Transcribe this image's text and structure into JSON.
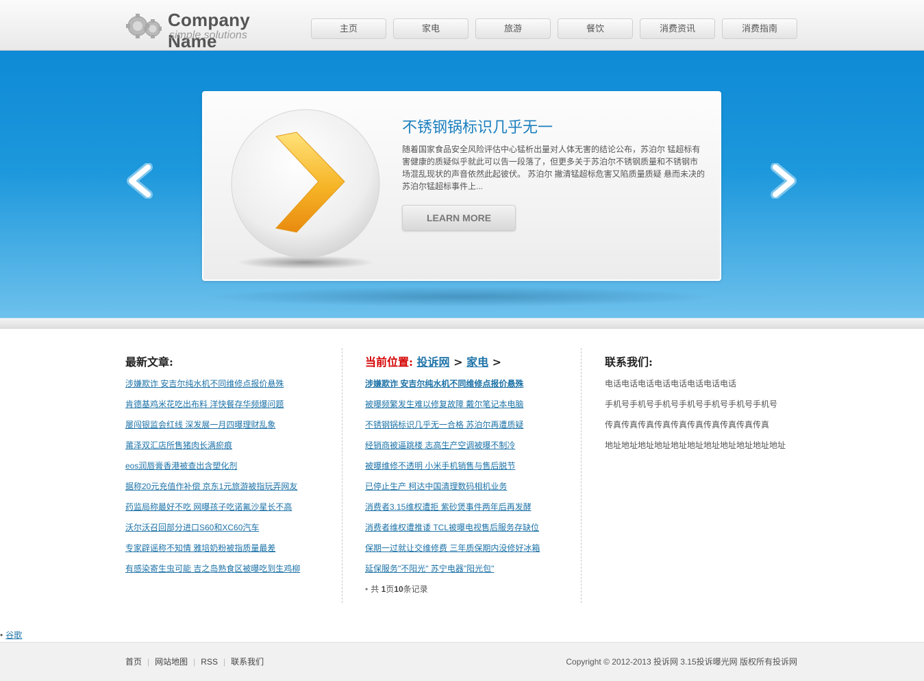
{
  "header": {
    "company_name": "Company Name",
    "tagline": "simple solutions",
    "nav": [
      "主页",
      "家电",
      "旅游",
      "餐饮",
      "消费资讯",
      "消费指南"
    ]
  },
  "slider": {
    "title": "不锈钢锅标识几乎无一",
    "text": "随着国家食品安全风险评估中心锰析出量对人体无害的结论公布，苏泊尔 锰超标有害健康的质疑似乎就此可以告一段落了，但更多关于苏泊尔不锈钢质量和不锈钢市场混乱现状的声音依然此起彼伏。 苏泊尔 撇清锰超标危害又陷质量质疑 悬而未决的苏泊尔锰超标事件上...",
    "button": "LEARN MORE"
  },
  "latest": {
    "title": "最新文章:",
    "items": [
      "涉嫌欺诈 安吉尔纯水机不同维修点报价悬殊",
      "肯德基鸡米花吃出布料 洋快餐存华频爆问题",
      "屡闯银监会红线 深发展一月四曝理财乱象",
      "莆泽双汇店所售猪肉长满瘀痕",
      "eos润唇膏香港被查出含塑化剂",
      "据称20元充值作补偿 京东1元旅游被指玩弄网友",
      "药监局称最好不吃 网曝孩子吃诺氟沙星长不高",
      "沃尔沃召回部分进口S60和XC60汽车",
      "专家辟谣称不知情 雅培奶粉被指质量最差",
      "有感染寄生虫可能 吉之岛熟食区被曝吃到生鸡柳"
    ]
  },
  "current": {
    "location_label": "当前位置:",
    "crumbs": [
      "投诉网",
      "家电"
    ],
    "sep": ">",
    "items": [
      "涉嫌欺诈 安吉尔纯水机不同维修点报价悬殊",
      "被曝频繁发生难以修复故障 戴尔笔记本电脑",
      "不锈钢锅标识几乎无一合格 苏泊尔再遭质疑",
      "经销商被逼跳楼 志高生产空调被曝不制冷",
      "被曝维修不透明 小米手机销售与售后脱节",
      "已停止生产 柯达中国清理数码相机业务",
      "消费者3.15维权遭拒 紫砂煲事件两年后再发酵",
      "消费者维权遭推诿 TCL被曝电视售后服务存缺位",
      "保期一过就让交维修费 三年质保期内没修好冰箱",
      "延保服务\"不阳光\" 苏宁电器\"阳光包\""
    ],
    "pager_prefix": "共",
    "pager_pages": "1",
    "pager_mid": "页",
    "pager_records": "10",
    "pager_suffix": "条记录"
  },
  "contact": {
    "title": "联系我们:",
    "items": [
      "电话电话电话电话电话电话电话电话",
      "手机号手机号手机号手机号手机号手机号手机号",
      "传真传真传真传真传真传真传真传真传真传真",
      "地址地址地址地址地址地址地址地址地址地址地址"
    ]
  },
  "extra_link": "谷歌",
  "footer": {
    "links": [
      "首页",
      "网站地图",
      "RSS",
      "联系我们"
    ],
    "copyright": "Copyright © 2012-2013 投诉网 3.15投诉曝光网 版权所有投诉网"
  },
  "colors": {
    "banner_blue": "#1d98dc",
    "link_blue": "#1e73a8",
    "title_blue": "#1b7fbe",
    "location_red": "#d40000"
  }
}
